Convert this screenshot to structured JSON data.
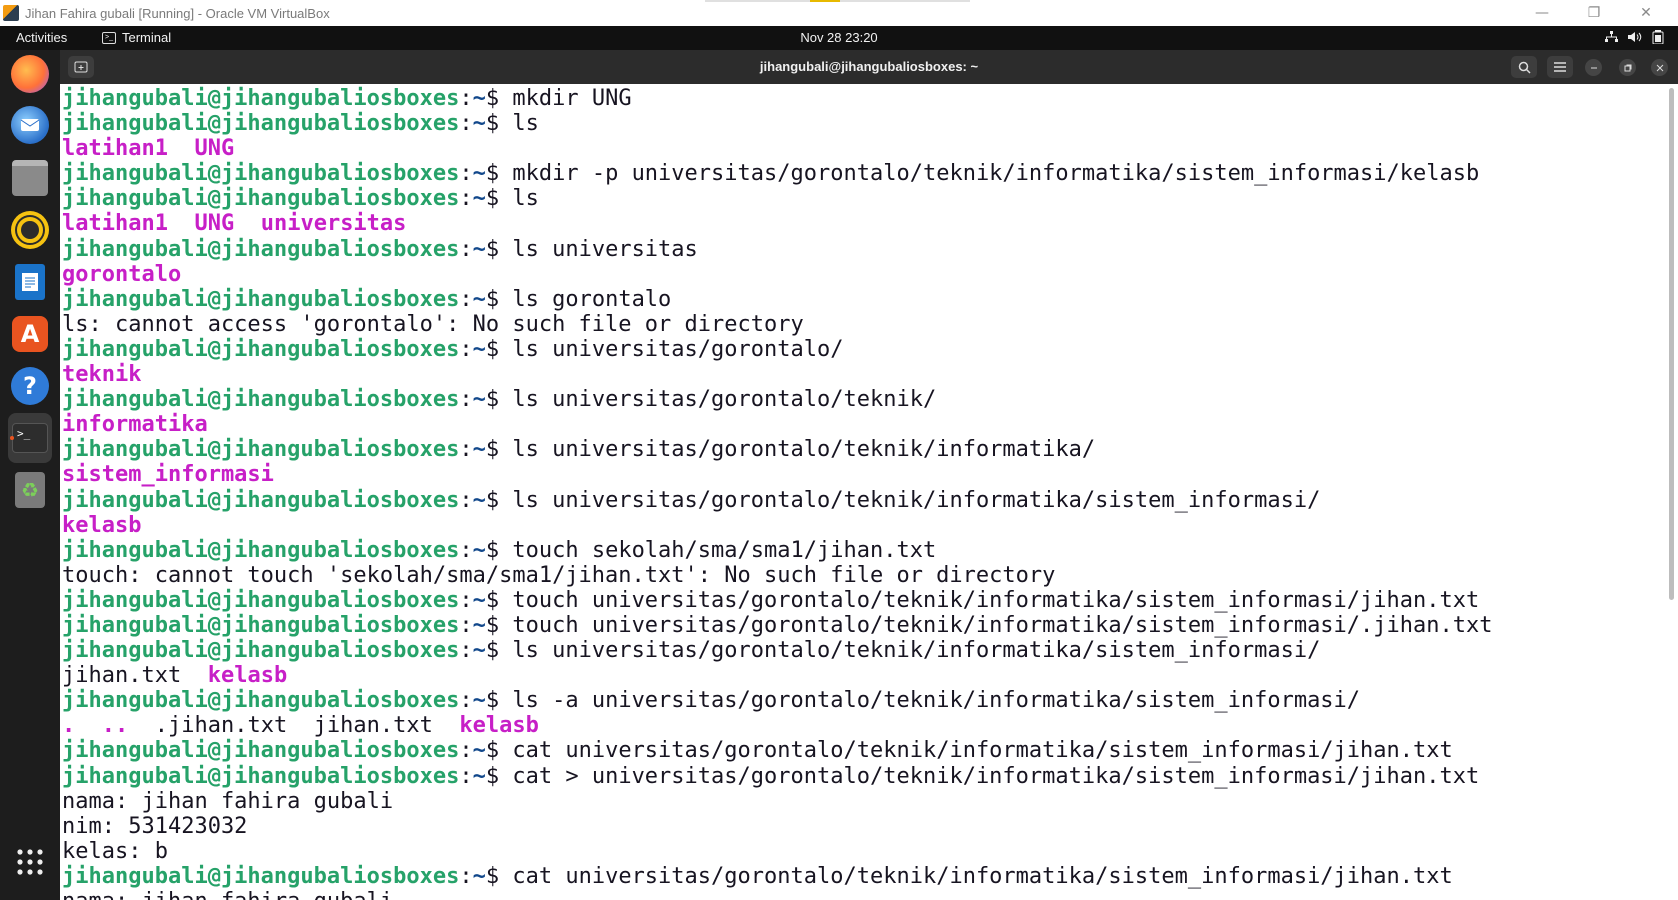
{
  "host_window": {
    "title": "Jihan Fahira gubali [Running] - Oracle VM VirtualBox",
    "controls": {
      "minimize": "—",
      "restore": "❐",
      "close": "✕"
    }
  },
  "gnome_topbar": {
    "activities": "Activities",
    "app_name": "Terminal",
    "clock": "Nov 28  23:20",
    "tray_icons": [
      "network-icon",
      "volume-icon",
      "battery-icon"
    ]
  },
  "dock": {
    "items": [
      {
        "name": "firefox",
        "color": "#ff7139"
      },
      {
        "name": "thunderbird",
        "color": "#2a6fc9"
      },
      {
        "name": "files",
        "color": "#8a8a8a"
      },
      {
        "name": "rhythmbox",
        "color": "#f5c211"
      },
      {
        "name": "writer",
        "color": "#1a73c9"
      },
      {
        "name": "app-center",
        "color": "#e95420"
      },
      {
        "name": "help",
        "color": "#2f7bd8"
      },
      {
        "name": "terminal",
        "color": "#2d2d2d"
      },
      {
        "name": "trash",
        "color": "#7a7a7a"
      }
    ],
    "apps_grid": "show-apps"
  },
  "terminal": {
    "title": "jihangubali@jihangubaliosboxes: ~",
    "prompt_user": "jihangubali@jihangubaliosboxes",
    "prompt_sep": ":",
    "prompt_path": "~",
    "prompt_end": "$ ",
    "colors": {
      "user": "#26a269",
      "path": "#12488b",
      "dir": "#c71fc7",
      "text": "#171421"
    },
    "lines": [
      {
        "kind": "cmd",
        "text": "mkdir UNG"
      },
      {
        "kind": "cmd",
        "text": "ls"
      },
      {
        "kind": "out",
        "parts": [
          {
            "t": "latihan1",
            "c": "dir"
          },
          {
            "t": "  ",
            "c": "plain"
          },
          {
            "t": "UNG",
            "c": "dir"
          }
        ]
      },
      {
        "kind": "cmd",
        "text": "mkdir -p universitas/gorontalo/teknik/informatika/sistem_informasi/kelasb"
      },
      {
        "kind": "cmd",
        "text": "ls"
      },
      {
        "kind": "out",
        "parts": [
          {
            "t": "latihan1",
            "c": "dir"
          },
          {
            "t": "  ",
            "c": "plain"
          },
          {
            "t": "UNG",
            "c": "dir"
          },
          {
            "t": "  ",
            "c": "plain"
          },
          {
            "t": "universitas",
            "c": "dir"
          }
        ]
      },
      {
        "kind": "cmd",
        "text": "ls universitas"
      },
      {
        "kind": "out",
        "parts": [
          {
            "t": "gorontalo",
            "c": "dir"
          }
        ]
      },
      {
        "kind": "cmd",
        "text": "ls gorontalo"
      },
      {
        "kind": "out",
        "parts": [
          {
            "t": "ls: cannot access 'gorontalo': No such file or directory",
            "c": "plain"
          }
        ]
      },
      {
        "kind": "cmd",
        "text": "ls universitas/gorontalo/"
      },
      {
        "kind": "out",
        "parts": [
          {
            "t": "teknik",
            "c": "dir"
          }
        ]
      },
      {
        "kind": "cmd",
        "text": "ls universitas/gorontalo/teknik/"
      },
      {
        "kind": "out",
        "parts": [
          {
            "t": "informatika",
            "c": "dir"
          }
        ]
      },
      {
        "kind": "cmd",
        "text": "ls universitas/gorontalo/teknik/informatika/"
      },
      {
        "kind": "out",
        "parts": [
          {
            "t": "sistem_informasi",
            "c": "dir"
          }
        ]
      },
      {
        "kind": "cmd",
        "text": "ls universitas/gorontalo/teknik/informatika/sistem_informasi/"
      },
      {
        "kind": "out",
        "parts": [
          {
            "t": "kelasb",
            "c": "dir"
          }
        ]
      },
      {
        "kind": "cmd",
        "text": "touch sekolah/sma/sma1/jihan.txt"
      },
      {
        "kind": "out",
        "parts": [
          {
            "t": "touch: cannot touch 'sekolah/sma/sma1/jihan.txt': No such file or directory",
            "c": "plain"
          }
        ]
      },
      {
        "kind": "cmd",
        "text": "touch universitas/gorontalo/teknik/informatika/sistem_informasi/jihan.txt"
      },
      {
        "kind": "cmd",
        "text": "touch universitas/gorontalo/teknik/informatika/sistem_informasi/.jihan.txt"
      },
      {
        "kind": "cmd",
        "text": "ls universitas/gorontalo/teknik/informatika/sistem_informasi/"
      },
      {
        "kind": "out",
        "parts": [
          {
            "t": "jihan.txt",
            "c": "plain"
          },
          {
            "t": "  ",
            "c": "plain"
          },
          {
            "t": "kelasb",
            "c": "dir"
          }
        ]
      },
      {
        "kind": "cmd",
        "text": "ls -a universitas/gorontalo/teknik/informatika/sistem_informasi/"
      },
      {
        "kind": "out",
        "parts": [
          {
            "t": ".",
            "c": "dir"
          },
          {
            "t": "  ",
            "c": "plain"
          },
          {
            "t": "..",
            "c": "dir"
          },
          {
            "t": "  .jihan.txt  jihan.txt  ",
            "c": "plain"
          },
          {
            "t": "kelasb",
            "c": "dir"
          }
        ]
      },
      {
        "kind": "cmd",
        "text": "cat universitas/gorontalo/teknik/informatika/sistem_informasi/jihan.txt"
      },
      {
        "kind": "cmd",
        "text": "cat > universitas/gorontalo/teknik/informatika/sistem_informasi/jihan.txt"
      },
      {
        "kind": "out",
        "parts": [
          {
            "t": "nama: jihan fahira gubali",
            "c": "plain"
          }
        ]
      },
      {
        "kind": "out",
        "parts": [
          {
            "t": "nim: 531423032",
            "c": "plain"
          }
        ]
      },
      {
        "kind": "out",
        "parts": [
          {
            "t": "kelas: b",
            "c": "plain"
          }
        ]
      },
      {
        "kind": "cmd",
        "text": "cat universitas/gorontalo/teknik/informatika/sistem_informasi/jihan.txt"
      },
      {
        "kind": "out",
        "parts": [
          {
            "t": "nama: jihan fahira gubali",
            "c": "plain"
          }
        ]
      }
    ]
  }
}
